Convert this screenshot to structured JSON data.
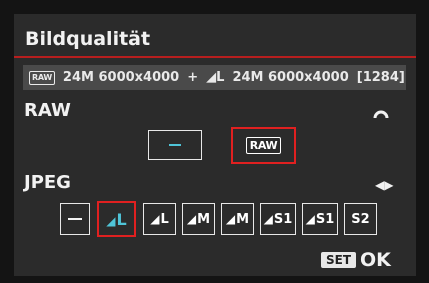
{
  "title": "Bildqualität",
  "info": {
    "raw_tag": "RAW",
    "raw_size": "24M 6000x4000",
    "plus": "+",
    "jpeg_icon": "◢",
    "jpeg_size_label": "L",
    "jpeg_size": "24M 6000x4000",
    "shots": "[1284]"
  },
  "raw": {
    "label": "RAW",
    "options": [
      {
        "id": "none",
        "label": "—"
      },
      {
        "id": "raw",
        "label": "RAW"
      }
    ],
    "selected": "RAW"
  },
  "jpeg": {
    "label": "JPEG",
    "nav_icon": "◀▶",
    "options": [
      "—",
      "L",
      "L",
      "M",
      "M",
      "S1",
      "S1",
      "S2"
    ],
    "selected_index": 1
  },
  "footer": {
    "set": "SET",
    "ok": "OK"
  },
  "colors": {
    "accent_red": "#e02020",
    "accent_cyan": "#4fc4d8",
    "panel": "#2b2b2b",
    "info_bar": "#4a4a4a"
  }
}
